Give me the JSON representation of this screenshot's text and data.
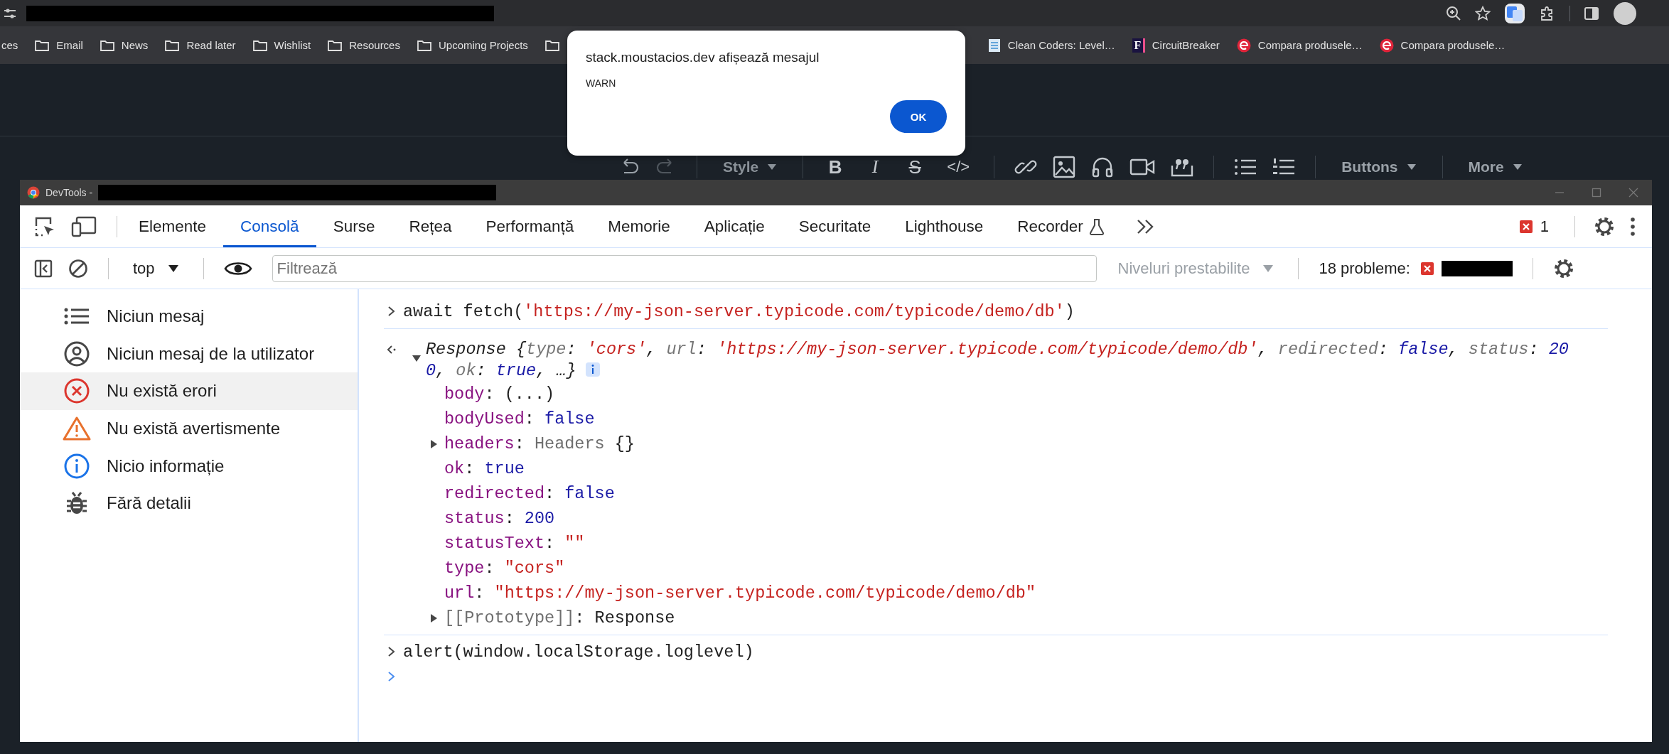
{
  "browser": {
    "bookmarks": [
      {
        "kind": "partial",
        "label": "ces"
      },
      {
        "kind": "folder",
        "label": "Email"
      },
      {
        "kind": "folder",
        "label": "News"
      },
      {
        "kind": "folder",
        "label": "Read later"
      },
      {
        "kind": "folder",
        "label": "Wishlist"
      },
      {
        "kind": "folder",
        "label": "Resources"
      },
      {
        "kind": "folder",
        "label": "Upcoming Projects"
      },
      {
        "kind": "folder"
      },
      {
        "kind": "site-book",
        "label": "Clean Coders: Level…"
      },
      {
        "kind": "site-letter",
        "favicon_text": "F",
        "label": "CircuitBreaker"
      },
      {
        "kind": "site-logo",
        "label": "Compara produsele…"
      },
      {
        "kind": "site-logo",
        "label": "Compara produsele…"
      }
    ]
  },
  "alert_dialog": {
    "title": "stack.moustacios.dev afișează mesajul",
    "message": "WARN",
    "button": "OK"
  },
  "editor_toolbar": {
    "style_label": "Style",
    "format_glyphs": [
      {
        "kind": "bold",
        "text": "B"
      },
      {
        "kind": "italic",
        "text": "I"
      },
      {
        "kind": "strike",
        "text": "S"
      },
      {
        "kind": "code",
        "text": "</>"
      }
    ],
    "buttons_label": "Buttons",
    "more_label": "More"
  },
  "devtools": {
    "title": "DevTools -",
    "tabs": [
      {
        "label": "Elemente",
        "selected": false
      },
      {
        "label": "Consolă",
        "selected": true
      },
      {
        "label": "Surse",
        "selected": false
      },
      {
        "label": "Rețea",
        "selected": false
      },
      {
        "label": "Performanță",
        "selected": false
      },
      {
        "label": "Memorie",
        "selected": false
      },
      {
        "label": "Aplicație",
        "selected": false
      },
      {
        "label": "Securitate",
        "selected": false
      },
      {
        "label": "Lighthouse",
        "selected": false
      },
      {
        "label": "Recorder",
        "selected": false
      }
    ],
    "error_count": "1",
    "console_toolbar": {
      "context": "top",
      "filter_placeholder": "Filtrează",
      "levels": "Niveluri prestabilite",
      "levels_disabled": true,
      "issues_label": "18 probleme:"
    },
    "sidebar": {
      "items": [
        {
          "kind": "all",
          "label": "Niciun mesaj",
          "selected": false
        },
        {
          "kind": "user",
          "label": "Niciun mesaj de la utilizator",
          "selected": false
        },
        {
          "kind": "error",
          "label": "Nu există erori",
          "selected": true
        },
        {
          "kind": "warning",
          "label": "Nu există avertismente",
          "selected": false
        },
        {
          "kind": "info",
          "label": "Nicio informație",
          "selected": false
        },
        {
          "kind": "verbose",
          "label": "Fără detalii",
          "selected": false
        }
      ]
    },
    "console": {
      "entries": [
        {
          "kind": "input",
          "tokens": [
            {
              "text": "await fetch(",
              "kind": "plain"
            },
            {
              "text": "'https://my-json-server.typicode.com/typicode/demo/db'",
              "kind": "string"
            },
            {
              "text": ")",
              "kind": "plain"
            }
          ]
        },
        {
          "kind": "result",
          "expanded": true,
          "summary": [
            {
              "text": "Response ",
              "kind": "plain"
            },
            {
              "text": "{",
              "kind": "plain"
            },
            {
              "text": "type",
              "kind": "dimkey"
            },
            {
              "text": ": ",
              "kind": "plain"
            },
            {
              "text": "'cors'",
              "kind": "string"
            },
            {
              "text": ", ",
              "kind": "plain"
            },
            {
              "text": "url",
              "kind": "dimkey"
            },
            {
              "text": ": ",
              "kind": "plain"
            },
            {
              "text": "'https://my-json-server.typicode.com/typicode/demo/db'",
              "kind": "string"
            },
            {
              "text": ", ",
              "kind": "plain"
            },
            {
              "text": "redirected",
              "kind": "dimkey"
            },
            {
              "text": ": ",
              "kind": "plain"
            },
            {
              "text": "false",
              "kind": "value"
            },
            {
              "text": ", ",
              "kind": "plain"
            },
            {
              "text": "status",
              "kind": "dimkey"
            },
            {
              "text": ": ",
              "kind": "plain"
            },
            {
              "text": "200",
              "kind": "value"
            },
            {
              "text": ", ",
              "kind": "plain"
            },
            {
              "text": "ok",
              "kind": "dimkey"
            },
            {
              "text": ": ",
              "kind": "plain"
            },
            {
              "text": "true",
              "kind": "value"
            },
            {
              "text": ", …}",
              "kind": "plain"
            }
          ],
          "properties": [
            {
              "kind": "leaf",
              "tokens": [
                {
                  "text": "body",
                  "kind": "key"
                },
                {
                  "text": ": ",
                  "kind": "plain"
                },
                {
                  "text": "(...)",
                  "kind": "plain"
                }
              ]
            },
            {
              "kind": "leaf",
              "tokens": [
                {
                  "text": "bodyUsed",
                  "kind": "key"
                },
                {
                  "text": ": ",
                  "kind": "plain"
                },
                {
                  "text": "false",
                  "kind": "value"
                }
              ]
            },
            {
              "kind": "node",
              "expanded": false,
              "tokens": [
                {
                  "text": "headers",
                  "kind": "key"
                },
                {
                  "text": ": ",
                  "kind": "plain"
                },
                {
                  "text": "Headers ",
                  "kind": "dim"
                },
                {
                  "text": "{}",
                  "kind": "plain"
                }
              ]
            },
            {
              "kind": "leaf",
              "tokens": [
                {
                  "text": "ok",
                  "kind": "key"
                },
                {
                  "text": ": ",
                  "kind": "plain"
                },
                {
                  "text": "true",
                  "kind": "value"
                }
              ]
            },
            {
              "kind": "leaf",
              "tokens": [
                {
                  "text": "redirected",
                  "kind": "key"
                },
                {
                  "text": ": ",
                  "kind": "plain"
                },
                {
                  "text": "false",
                  "kind": "value"
                }
              ]
            },
            {
              "kind": "leaf",
              "tokens": [
                {
                  "text": "status",
                  "kind": "key"
                },
                {
                  "text": ": ",
                  "kind": "plain"
                },
                {
                  "text": "200",
                  "kind": "value"
                }
              ]
            },
            {
              "kind": "leaf",
              "tokens": [
                {
                  "text": "statusText",
                  "kind": "key"
                },
                {
                  "text": ": ",
                  "kind": "plain"
                },
                {
                  "text": "\"\"",
                  "kind": "string"
                }
              ]
            },
            {
              "kind": "leaf",
              "tokens": [
                {
                  "text": "type",
                  "kind": "key"
                },
                {
                  "text": ": ",
                  "kind": "plain"
                },
                {
                  "text": "\"cors\"",
                  "kind": "string"
                }
              ]
            },
            {
              "kind": "leaf",
              "tokens": [
                {
                  "text": "url",
                  "kind": "key"
                },
                {
                  "text": ": ",
                  "kind": "plain"
                },
                {
                  "text": "\"https://my-json-server.typicode.com/typicode/demo/db\"",
                  "kind": "string"
                }
              ]
            },
            {
              "kind": "node",
              "expanded": false,
              "tokens": [
                {
                  "text": "[[Prototype]]",
                  "kind": "dim"
                },
                {
                  "text": ": ",
                  "kind": "plain"
                },
                {
                  "text": "Response",
                  "kind": "plain"
                }
              ]
            }
          ]
        },
        {
          "kind": "input",
          "tokens": [
            {
              "text": "alert(window.localStorage.loglevel)",
              "kind": "plain"
            }
          ]
        },
        {
          "kind": "prompt"
        }
      ]
    }
  }
}
